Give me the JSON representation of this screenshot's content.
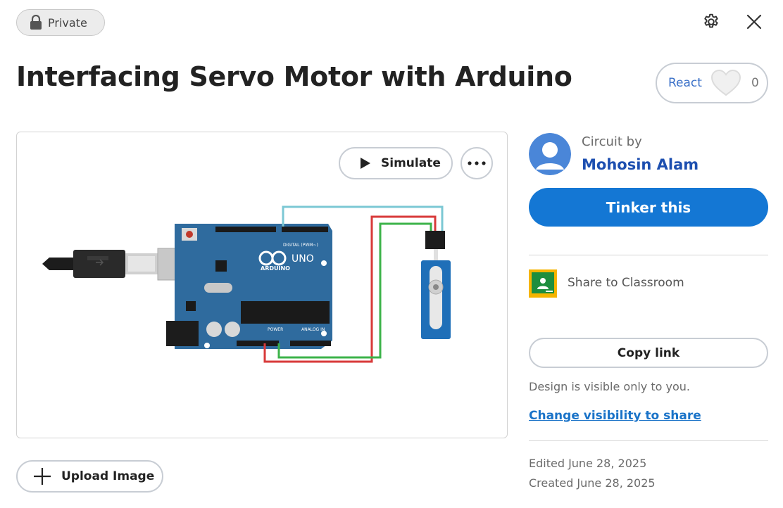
{
  "header": {
    "privacy_label": "Private",
    "title": "Interfacing Servo Motor with Arduino"
  },
  "react": {
    "label": "React",
    "count": "0"
  },
  "canvas": {
    "simulate_label": "Simulate",
    "board": {
      "brand": "ARDUINO",
      "model": "UNO",
      "digital_label": "DIGITAL (PWM~)",
      "power_label": "POWER",
      "analog_label": "ANALOG IN"
    }
  },
  "upload": {
    "label": "Upload Image"
  },
  "author": {
    "circuit_by": "Circuit by",
    "name": "Mohosin Alam"
  },
  "actions": {
    "tinker_label": "Tinker this",
    "classroom_label": "Share to Classroom",
    "copy_link_label": "Copy link",
    "visibility_note": "Design is visible only to you.",
    "change_visibility": "Change visibility to share"
  },
  "dates": {
    "edited": "Edited June 28, 2025",
    "created": "Created June 28, 2025"
  },
  "colors": {
    "primary": "#1477d4",
    "author_link": "#1d4fb0",
    "board_blue": "#2e6a9e",
    "wire_cyan": "#7cc8d4",
    "wire_red": "#d83a3a",
    "wire_green": "#3cb34a",
    "servo_blue": "#1f6fb8"
  },
  "icons": {
    "lock": "lock-icon",
    "settings": "gear-icon",
    "close": "close-icon",
    "heart": "heart-icon",
    "play": "play-icon",
    "more": "more-horizontal-icon",
    "plus": "plus-icon",
    "classroom": "google-classroom-icon",
    "avatar": "user-avatar-icon"
  }
}
